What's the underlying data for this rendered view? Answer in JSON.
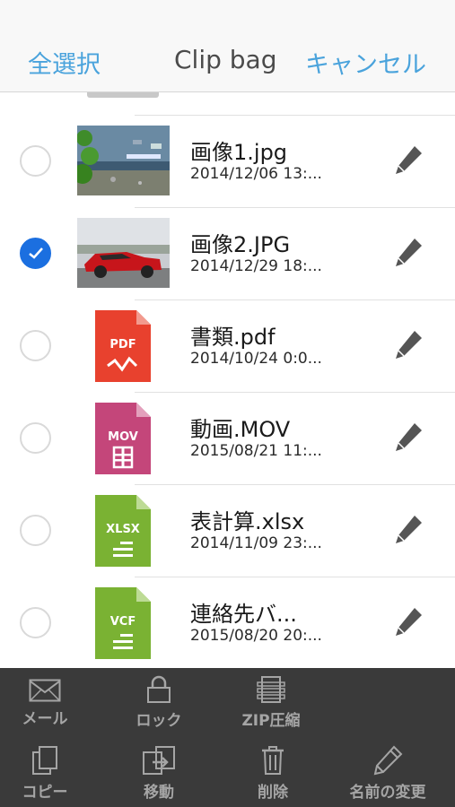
{
  "navbar": {
    "select_all": "全選択",
    "title": "Clip bag",
    "cancel": "キャンセル"
  },
  "files": [
    {
      "name": "画像1.jpg",
      "date": "2014/12/06 13:...",
      "kind": "image-aquarium",
      "selected": false
    },
    {
      "name": "画像2.JPG",
      "date": "2014/12/29 18:...",
      "kind": "image-car",
      "selected": true
    },
    {
      "name": "書類.pdf",
      "date": "2014/10/24 0:0...",
      "kind": "pdf",
      "badge": "PDF",
      "color": "#e8412e",
      "selected": false
    },
    {
      "name": "動画.MOV",
      "date": "2015/08/21 11:...",
      "kind": "mov",
      "badge": "MOV",
      "color": "#c4467a",
      "selected": false
    },
    {
      "name": "表計算.xlsx",
      "date": "2014/11/09 23:...",
      "kind": "xlsx",
      "badge": "XLSX",
      "color": "#7ab233",
      "selected": false
    },
    {
      "name": "連絡先バ...",
      "date": "2015/08/20 20:...",
      "kind": "vcf",
      "badge": "VCF",
      "color": "#7ab233",
      "selected": false
    }
  ],
  "toolbar": {
    "mail": "メール",
    "lock": "ロック",
    "zip": "ZIP圧縮",
    "copy": "コピー",
    "move": "移動",
    "delete": "削除",
    "rename": "名前の変更"
  },
  "colors": {
    "accent": "#4aa3dc",
    "selected": "#1b6fe0",
    "toolbar_bg": "#3a3a3a",
    "toolbar_text": "#a5a5a5"
  },
  "icons": {
    "edit": "pencil-icon",
    "mail": "envelope-icon",
    "lock": "lock-icon",
    "zip": "archive-icon",
    "copy": "copy-icon",
    "move": "move-icon",
    "delete": "trash-icon",
    "rename": "pencil-icon"
  }
}
